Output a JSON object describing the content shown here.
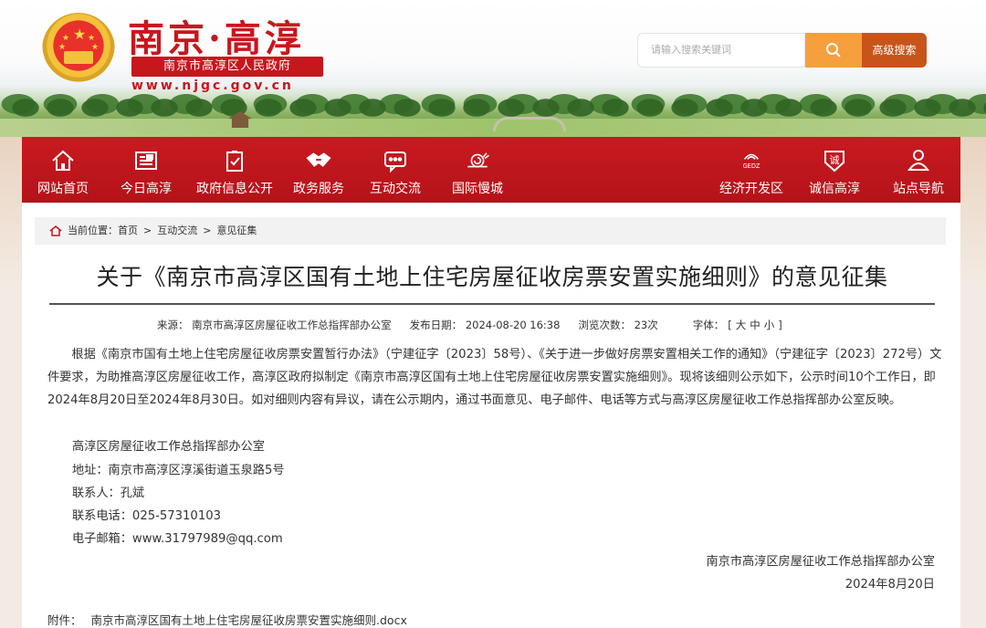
{
  "header": {
    "site_title": "南京·高淳",
    "site_subtitle": "南京市高淳区人民政府",
    "site_url": "www.njgc.gov.cn",
    "search_placeholder": "请输入搜索关键词",
    "search_icon": "search-icon",
    "advanced_search_label": "高级搜索",
    "brand_color": "#c8161d"
  },
  "nav": {
    "items": [
      {
        "label": "网站首页",
        "icon": "home-icon"
      },
      {
        "label": "今日高淳",
        "icon": "newspaper-icon"
      },
      {
        "label": "政府信息公开",
        "icon": "checklist-icon"
      },
      {
        "label": "政务服务",
        "icon": "handshake-icon"
      },
      {
        "label": "互动交流",
        "icon": "chat-icon"
      },
      {
        "label": "国际慢城",
        "icon": "snail-icon"
      },
      {
        "label": "经济开发区",
        "icon": "gedz-icon",
        "badge": "GEDZ"
      },
      {
        "label": "诚信高淳",
        "icon": "integrity-icon",
        "badge": "诚"
      },
      {
        "label": "站点导航",
        "icon": "location-user-icon"
      }
    ],
    "bg_color": "#c0161d"
  },
  "breadcrumb": {
    "prefix": "当前位置：",
    "items": [
      "首页",
      "互动交流",
      "意见征集"
    ],
    "separator": ">"
  },
  "article": {
    "title": "关于《南京市高淳区国有土地上住宅房屋征收房票安置实施细则》的意见征集",
    "meta": {
      "source_label": "来源：",
      "source": "南京市高淳区房屋征收工作总指挥部办公室",
      "date_label": "发布日期：",
      "date": "2024-08-20 16:38",
      "views_label": "浏览次数：",
      "views": "23次",
      "font_label": "字体：",
      "font_open": "[",
      "font_sizes": [
        "大",
        "中",
        "小"
      ],
      "font_close": "]"
    },
    "paragraph": "根据《南京市国有土地上住宅房屋征收房票安置暂行办法》（宁建征字〔2023〕58号）、《关于进一步做好房票安置相关工作的通知》（宁建征字〔2023〕272号）文件要求，为助推高淳区房屋征收工作，高淳区政府拟制定《南京市高淳区国有土地上住宅房屋征收房票安置实施细则》。现将该细则公示如下，公示时间10个工作日，即2024年8月20日至2024年8月30日。如对细则内容有异议，请在公示期内，通过书面意见、电子邮件、电话等方式与高淳区房屋征收工作总指挥部办公室反映。",
    "contact_lines": [
      "高淳区房屋征收工作总指挥部办公室",
      "地址：南京市高淳区淳溪街道玉泉路5号",
      "联系人：孔斌",
      "联系电话：025-57310103",
      "电子邮箱：www.31797989@qq.com"
    ],
    "signature": "南京市高淳区房屋征收工作总指挥部办公室",
    "sign_date": "2024年8月20日",
    "attachment_label": "附件：",
    "attachment_name": "南京市高淳区国有土地上住宅房屋征收房票安置实施细则.docx"
  }
}
